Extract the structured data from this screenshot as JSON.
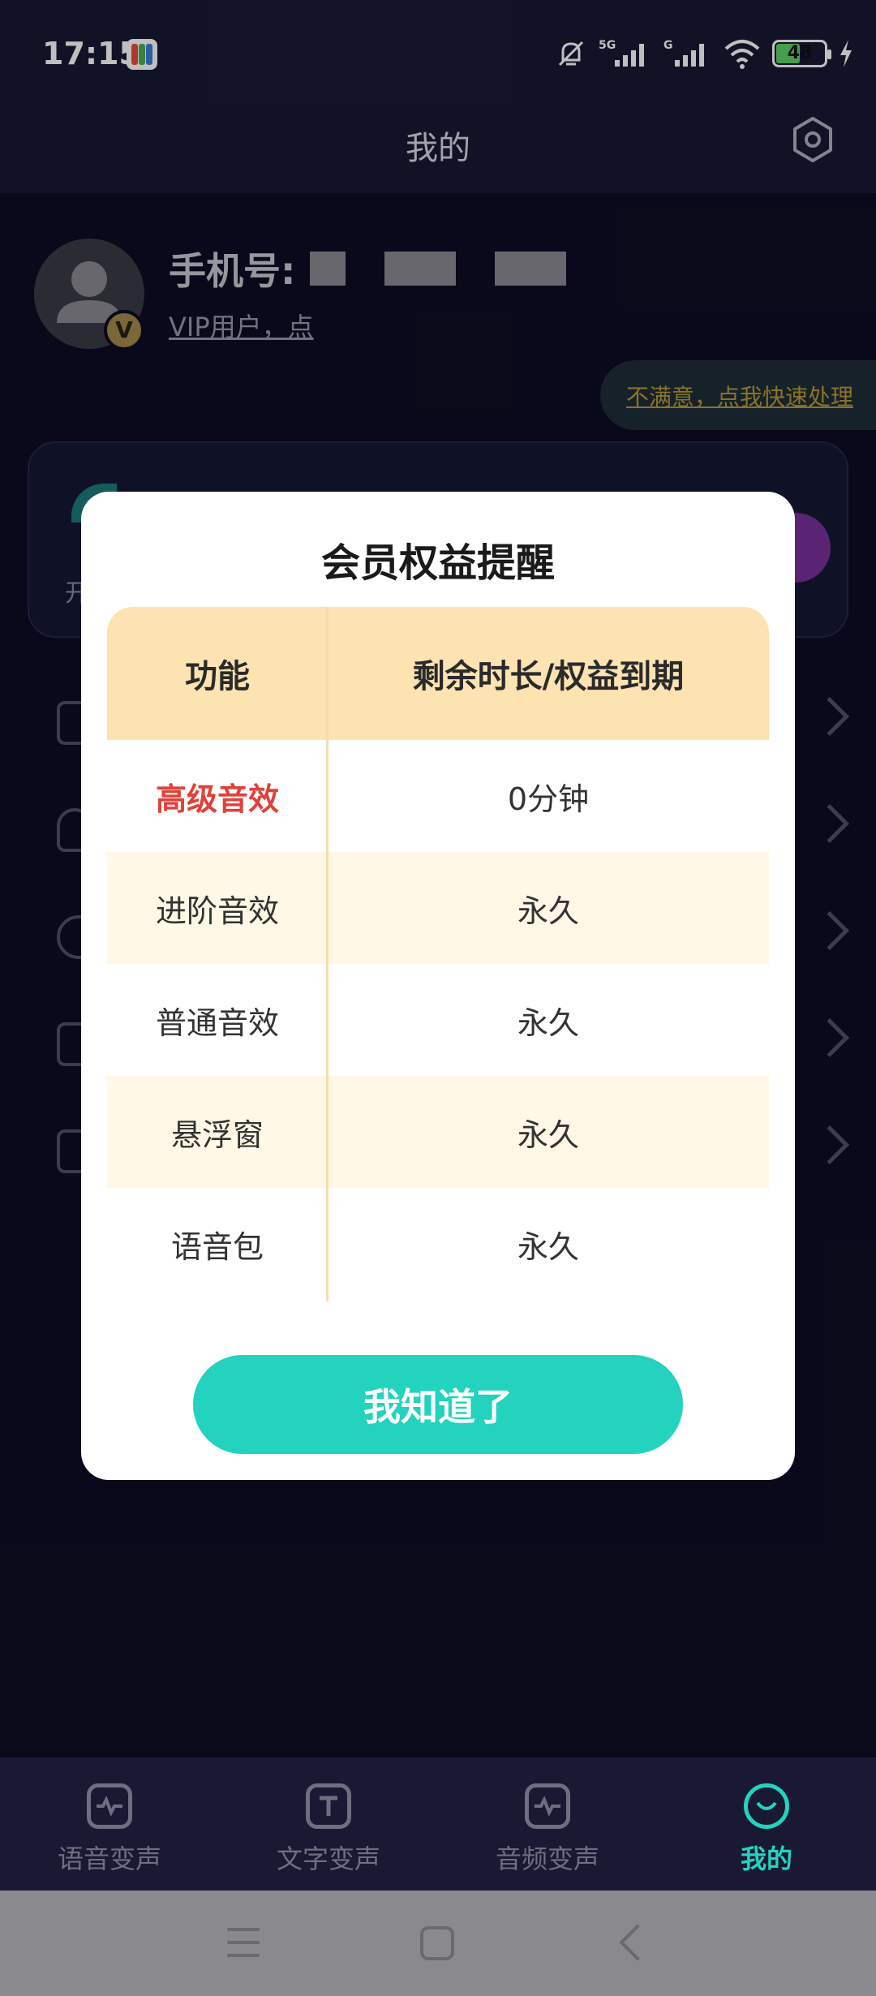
{
  "status_bar": {
    "time": "17:15",
    "battery_level": "48",
    "network_labels": [
      "5G",
      "G"
    ]
  },
  "header": {
    "title": "我的"
  },
  "profile": {
    "phone_label": "手机号:",
    "vip_text": "VIP用户，点",
    "complaint_link": "不满意，点我快速处理",
    "card_text": "开"
  },
  "dialog": {
    "title": "会员权益提醒",
    "columns": [
      "功能",
      "剩余时长/权益到期"
    ],
    "rows": [
      {
        "feature": "高级音效",
        "value": "0分钟"
      },
      {
        "feature": "进阶音效",
        "value": "永久"
      },
      {
        "feature": "普通音效",
        "value": "永久"
      },
      {
        "feature": "悬浮窗",
        "value": "永久"
      },
      {
        "feature": "语音包",
        "value": "永久"
      }
    ],
    "confirm_label": "我知道了"
  },
  "tabs": [
    {
      "label": "语音变声",
      "icon": "voice-wave-icon"
    },
    {
      "label": "文字变声",
      "icon": "text-t-icon"
    },
    {
      "label": "音频变声",
      "icon": "audio-wave-icon"
    },
    {
      "label": "我的",
      "icon": "smile-face-icon",
      "active": true
    }
  ],
  "colors": {
    "accent": "#23d3bd",
    "header_row": "#fde2b2",
    "alt_row": "#fff8e6",
    "highlight_text": "#e0413a"
  }
}
